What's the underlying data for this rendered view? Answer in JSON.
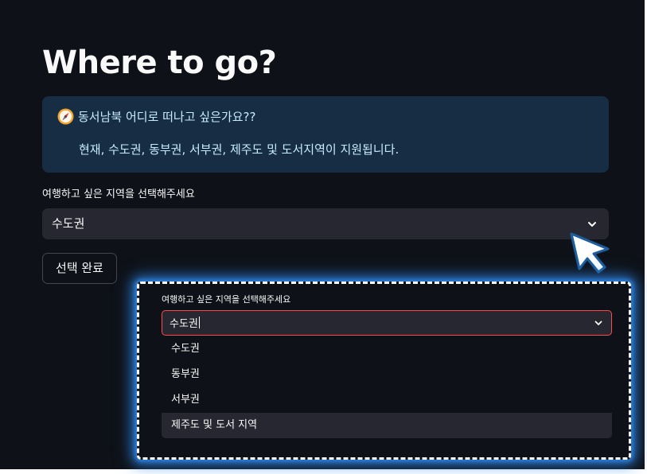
{
  "page": {
    "title": "Where to go?"
  },
  "info": {
    "icon": "compass-icon",
    "line1": "동서남북 어디로 떠나고 싶은가요??",
    "line2": "현재, 수도권, 동부권, 서부권, 제주도 및 도서지역이 지원됩니다."
  },
  "region_select": {
    "label": "여행하고 싶은 지역을 선택해주세요",
    "selected": "수도권"
  },
  "confirm_button": {
    "label": "선택 완료"
  },
  "inset": {
    "label": "여행하고 싶은 지역을 선택해주세요",
    "input_value": "수도권",
    "options": [
      {
        "label": "수도권",
        "highlighted": false
      },
      {
        "label": "동부권",
        "highlighted": false
      },
      {
        "label": "서부권",
        "highlighted": false
      },
      {
        "label": "제주도 및 도서 지역",
        "highlighted": true
      }
    ]
  },
  "colors": {
    "app_background": "#0e1117",
    "info_background": "#172d43",
    "info_text": "#c7ebff",
    "input_background": "#262730",
    "focus_border": "#ff4b4b",
    "highlight_glow": "#2f86e6",
    "cursor_fill": "#ffffff",
    "cursor_outline": "#1f5d9c"
  }
}
